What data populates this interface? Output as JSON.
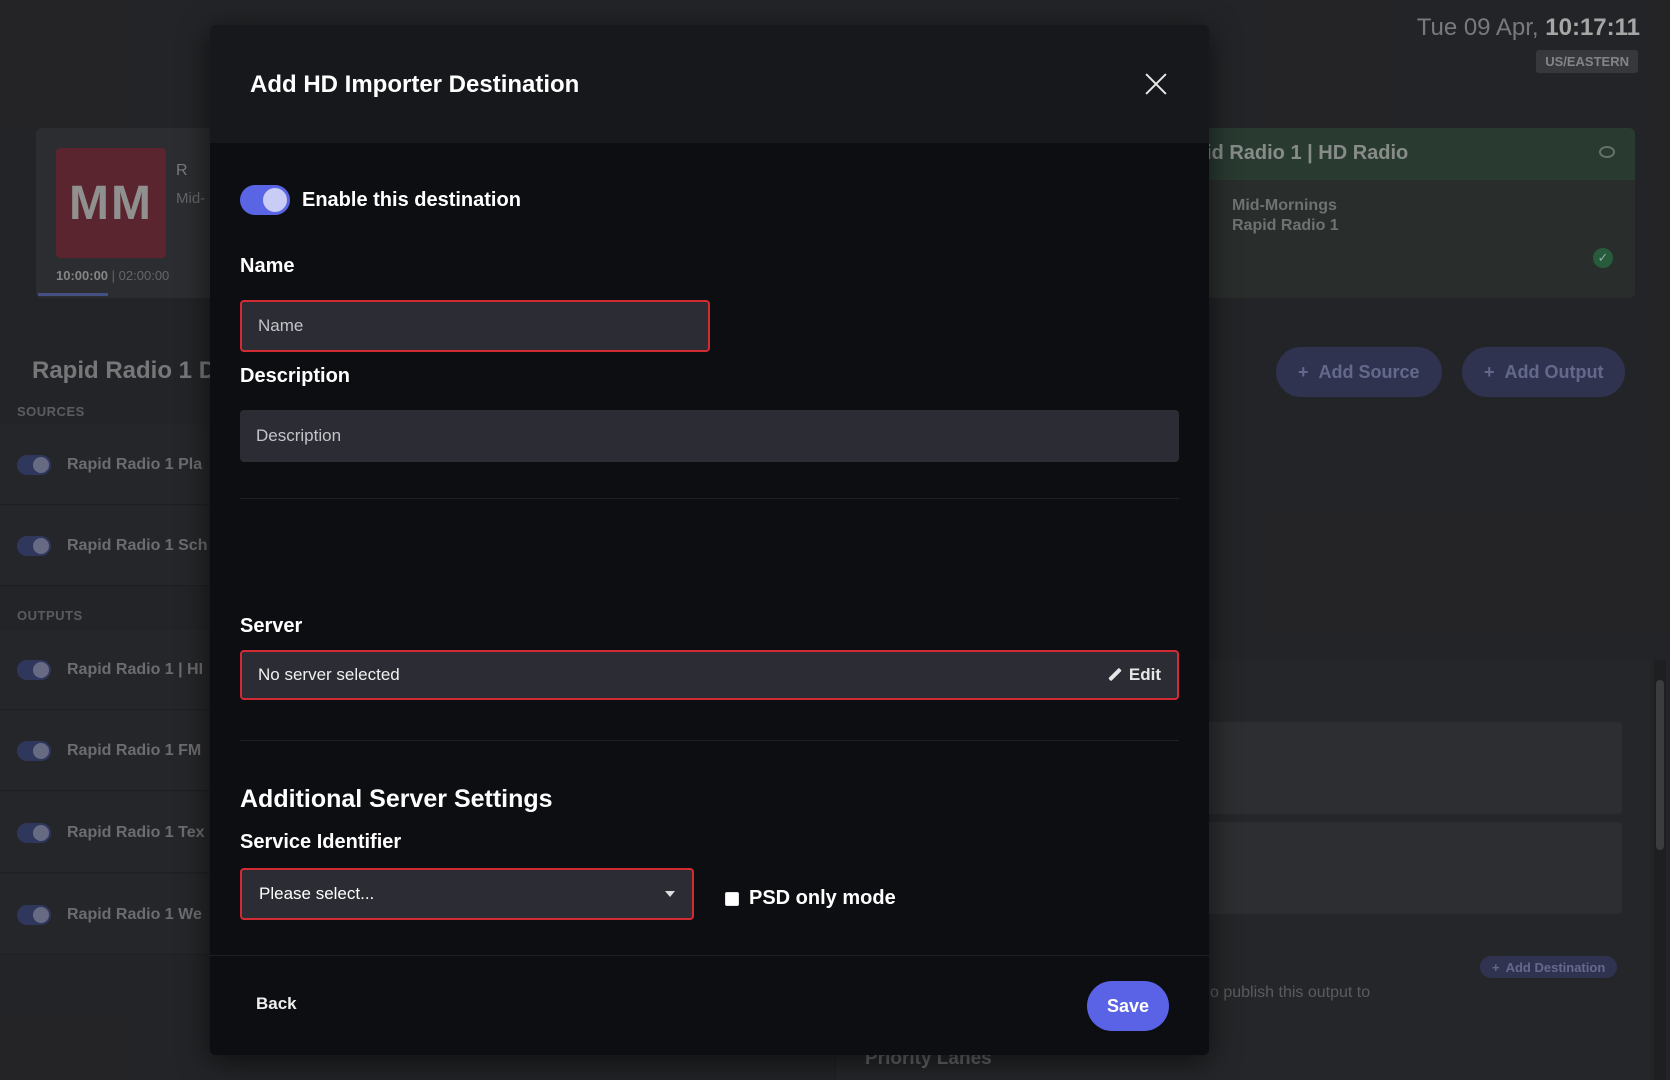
{
  "background": {
    "clock": {
      "date": "Tue 09 Apr,",
      "time": "10:17:11",
      "timezone": "US/EASTERN"
    },
    "now_playing": {
      "art_text": "MM",
      "title_partial": "R",
      "subtitle_partial": "Mid-",
      "elapsed": "10:00:00",
      "duration": "02:00:00"
    },
    "output_card": {
      "title": "id Radio 1 | HD Radio",
      "show": "Mid-Mornings",
      "station": "Rapid Radio 1"
    },
    "section_title": "Rapid Radio 1 Da",
    "add_source_label": "Add Source",
    "add_output_label": "Add Output",
    "sources_label": "SOURCES",
    "outputs_label": "OUTPUTS",
    "sources": [
      "Rapid Radio 1 Pla",
      "Rapid Radio 1 Sch"
    ],
    "outputs": [
      "Rapid Radio 1 | HI",
      "Rapid Radio 1 FM",
      "Rapid Radio 1 Tex",
      "Rapid Radio 1 We"
    ],
    "add_destination_label": "Add Destination",
    "publish_text": "o publish this output to",
    "priority_lanes": "Priority Lanes"
  },
  "modal": {
    "title": "Add HD Importer Destination",
    "enable_label": "Enable this destination",
    "enabled": true,
    "name": {
      "label": "Name",
      "value": "",
      "placeholder": "Name"
    },
    "description": {
      "label": "Description",
      "value": "",
      "placeholder": "Description"
    },
    "server": {
      "label": "Server",
      "value": "No server selected",
      "edit_label": "Edit"
    },
    "additional_heading": "Additional Server Settings",
    "service_identifier": {
      "label": "Service Identifier",
      "selected": "Please select..."
    },
    "psd_only": {
      "label": "PSD only mode",
      "checked": false
    },
    "back_label": "Back",
    "save_label": "Save"
  },
  "colors": {
    "accent": "#5a62e6",
    "error": "#d22b36",
    "modal_bg": "#0d0e12"
  }
}
